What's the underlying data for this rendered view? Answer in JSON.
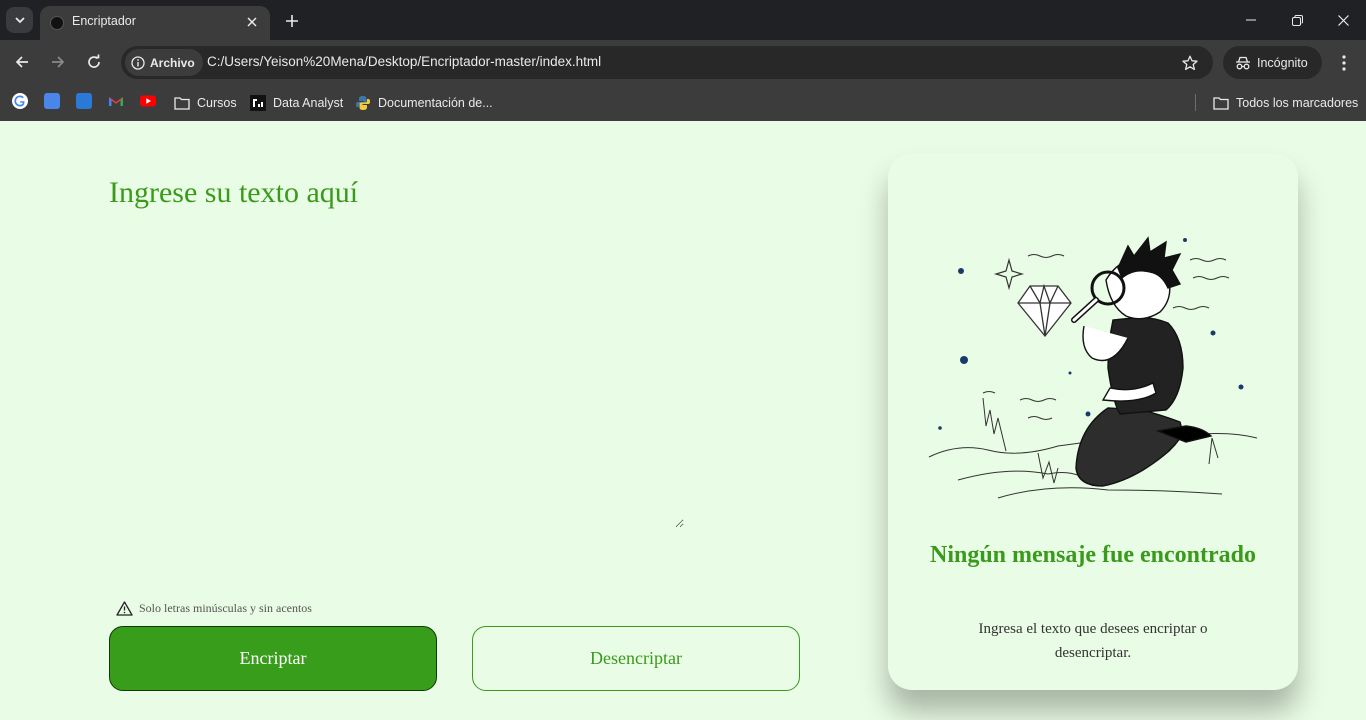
{
  "browser": {
    "tab_title": "Encriptador",
    "site_chip": "Archivo",
    "url": "C:/Users/Yeison%20Mena/Desktop/Encriptador-master/index.html",
    "incognito_label": "Incógnito",
    "bookmarks": {
      "folder_cursos": "Cursos",
      "data_analyst": "Data Analyst",
      "documentacion": "Documentación de...",
      "all_bookmarks": "Todos los marcadores"
    }
  },
  "page": {
    "heading": "Ingrese su texto aquí",
    "textarea_value": "",
    "hint": "Solo letras minúsculas y sin acentos",
    "encrypt_button": "Encriptar",
    "decrypt_button": "Desencriptar",
    "result": {
      "title": "Ningún mensaje fue encontrado",
      "description": "Ingresa el texto que desees encriptar o desencriptar."
    }
  },
  "colors": {
    "background": "#e9fce5",
    "accent_green": "#3a9a1c",
    "button_green": "#389d1a",
    "chrome_dark": "#202124",
    "chrome_toolbar": "#3c3c3c"
  },
  "icons": [
    "tab-list-icon",
    "close-icon",
    "plus-icon",
    "minimize-icon",
    "restore-icon",
    "back-icon",
    "forward-icon",
    "reload-icon",
    "info-icon",
    "star-icon",
    "incognito-icon",
    "kebab-icon",
    "folder-icon",
    "warning-icon"
  ]
}
